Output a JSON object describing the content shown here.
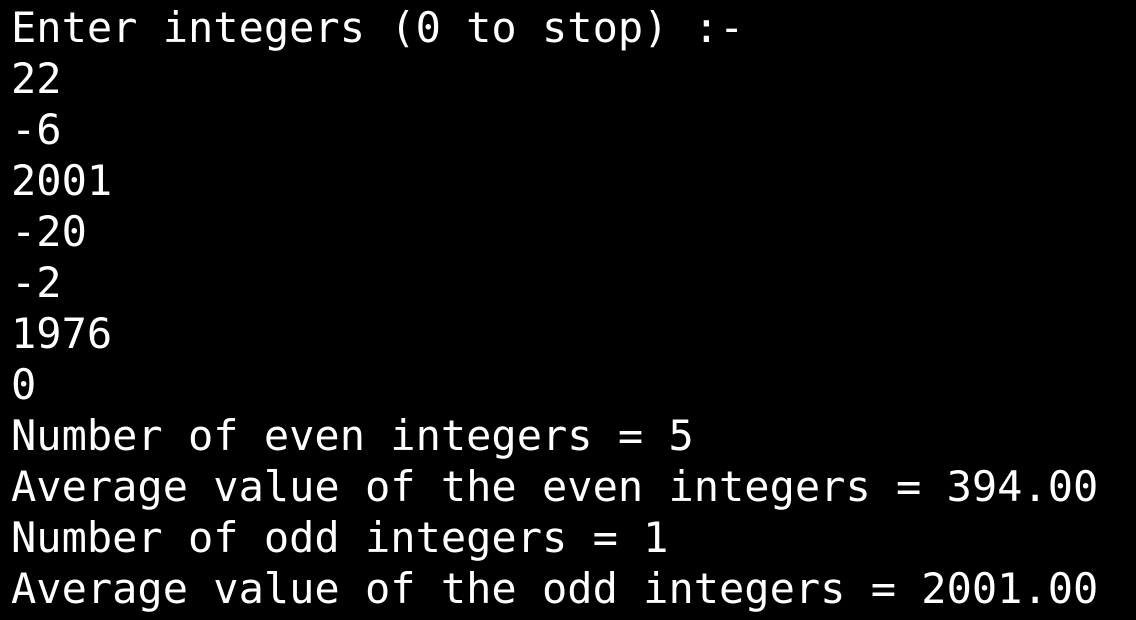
{
  "terminal": {
    "lines": [
      "Enter integers (0 to stop) :-",
      "22",
      "-6",
      "2001",
      "-20",
      "-2",
      "1976",
      "0",
      "Number of even integers = 5",
      "Average value of the even integers = 394.00",
      "Number of odd integers = 1",
      "Average value of the odd integers = 2001.00"
    ]
  }
}
